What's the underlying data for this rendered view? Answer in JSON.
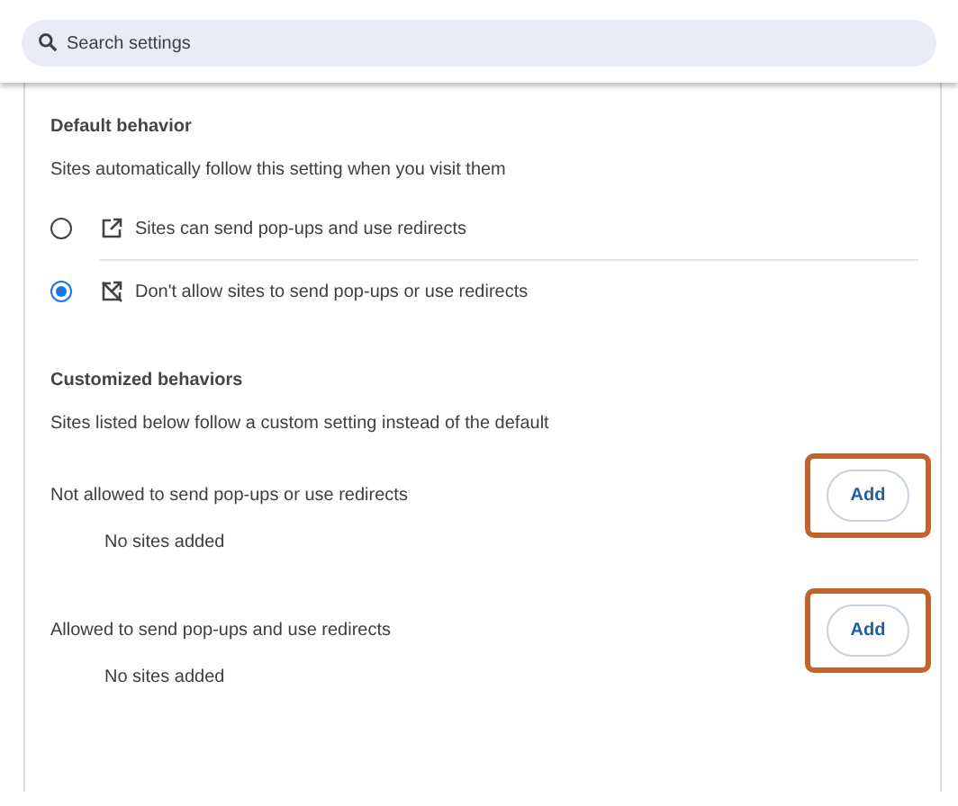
{
  "search": {
    "placeholder": "Search settings"
  },
  "default_behavior": {
    "heading": "Default behavior",
    "description": "Sites automatically follow this setting when you visit them",
    "options": [
      {
        "kind": "allow",
        "label": "Sites can send pop-ups and use redirects",
        "selected": false
      },
      {
        "kind": "block",
        "label": "Don't allow sites to send pop-ups or use redirects",
        "selected": true
      }
    ]
  },
  "customized_behaviors": {
    "heading": "Customized behaviors",
    "description": "Sites listed below follow a custom setting instead of the default",
    "lists": [
      {
        "label": "Not allowed to send pop-ups or use redirects",
        "button": "Add",
        "empty_text": "No sites added",
        "highlighted": true
      },
      {
        "label": "Allowed to send pop-ups and use redirects",
        "button": "Add",
        "empty_text": "No sites added",
        "highlighted": true
      }
    ]
  }
}
